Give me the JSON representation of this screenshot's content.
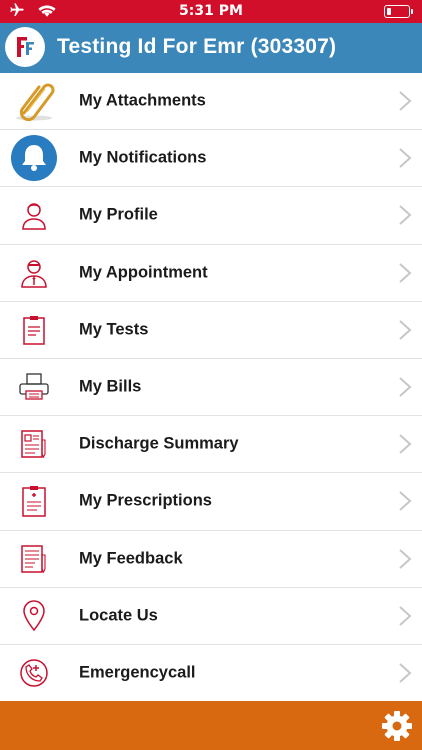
{
  "status_bar": {
    "time": "5:31 PM"
  },
  "header": {
    "title": "Testing Id For Emr (303307)"
  },
  "menu": {
    "items": [
      {
        "label": "My Attachments",
        "icon": "paperclip-icon"
      },
      {
        "label": "My Notifications",
        "icon": "bell-icon"
      },
      {
        "label": "My Profile",
        "icon": "user-icon"
      },
      {
        "label": "My Appointment",
        "icon": "doctor-icon"
      },
      {
        "label": "My Tests",
        "icon": "clipboard-icon"
      },
      {
        "label": "My Bills",
        "icon": "printer-icon"
      },
      {
        "label": "Discharge Summary",
        "icon": "report-icon"
      },
      {
        "label": "My Prescriptions",
        "icon": "prescription-icon"
      },
      {
        "label": "My Feedback",
        "icon": "feedback-form-icon"
      },
      {
        "label": "Locate Us",
        "icon": "location-pin-icon"
      },
      {
        "label": "Emergencycall",
        "icon": "emergency-call-icon"
      }
    ]
  },
  "colors": {
    "status_bar": "#d20f2a",
    "header": "#3b87b9",
    "footer": "#d86910",
    "icon_red": "#c8102e"
  }
}
